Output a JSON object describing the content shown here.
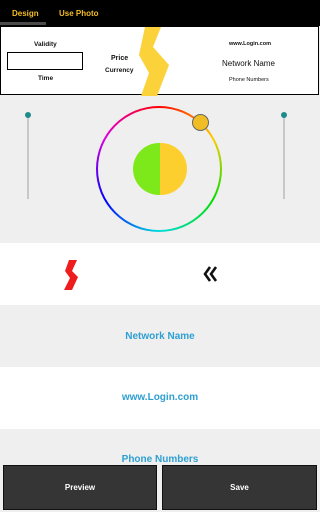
{
  "tabs": [
    {
      "label": "Design",
      "active": true
    },
    {
      "label": "Use Photo",
      "active": false
    }
  ],
  "card": {
    "validity_label": "Validity",
    "time_label": "Time",
    "price_label": "Price",
    "currency_label": "Currency",
    "website": "www.Login.com",
    "network_name": "Network Name",
    "phone_numbers": "Phone Numbers",
    "accent_color": "#fbd23a"
  },
  "color_picker": {
    "left_color": "#7ee91a",
    "right_color": "#fdcf2e",
    "handle_color": "#f1bd24"
  },
  "fields": {
    "network_name": "Network Name",
    "website": "www.Login.com",
    "phone_numbers": "Phone Numbers"
  },
  "shape_selector": {
    "left_icon": "red-zigzag-icon",
    "right_icon": "double-chevron-left-icon"
  },
  "buttons": {
    "preview": "Preview",
    "save": "Save"
  },
  "colors": {
    "tab_text": "#f4bd23",
    "field_text": "#2d9fd2",
    "button_bg": "#353535"
  }
}
